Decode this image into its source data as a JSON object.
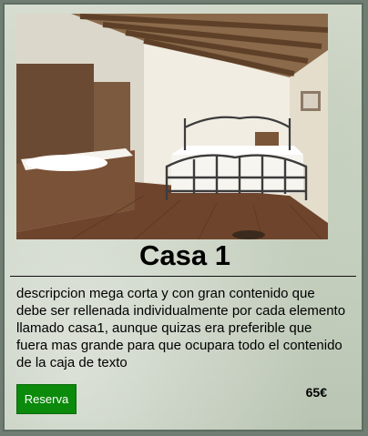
{
  "card": {
    "image_alt": "bedroom with wooden beams, iron bed and jacuzzi",
    "title": "Casa 1",
    "description": "descripcion mega corta y con gran contenido que debe ser rellenada individualmente por cada elemento llamado casa1, aunque quizas era preferible que fuera mas grande para que ocupara todo el contenido de la caja de texto",
    "button_label": "Reserva",
    "price": "65€"
  },
  "colors": {
    "button_bg": "#0b8a0b",
    "card_border": "#5d6e61"
  }
}
